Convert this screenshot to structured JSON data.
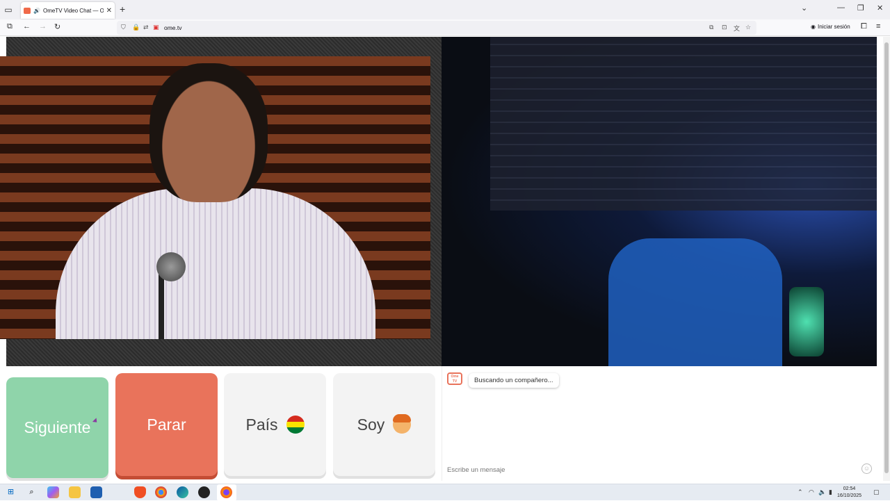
{
  "browser": {
    "tab_title": "OmeTV Video Chat — Ome",
    "tab_close": "✕",
    "new_tab": "+",
    "url": "ome.tv",
    "login_label": "Iniciar sesión",
    "window_controls": [
      "⌄",
      "—",
      "❐",
      "✕"
    ]
  },
  "actions": {
    "next_label": "Siguiente",
    "stop_label": "Parar",
    "country_label": "País",
    "gender_label": "Soy"
  },
  "chat": {
    "logo_text": "Ome TV",
    "status_message": "Buscando un compañero...",
    "input_placeholder": "Escribe un mensaje",
    "emoji_icon": "smiley-icon"
  },
  "taskbar": {
    "time": "02:54",
    "date": "16/10/2025",
    "apps": [
      "windows-start",
      "search",
      "copilot",
      "file-explorer",
      "store",
      "brave",
      "chrome",
      "edge",
      "obs",
      "firefox"
    ]
  },
  "colors": {
    "next": "#8fd4aa",
    "stop": "#e9735b",
    "neutral": "#f3f3f3",
    "flag_bolivia": [
      "#d52b1e",
      "#f9e300",
      "#007934"
    ]
  }
}
